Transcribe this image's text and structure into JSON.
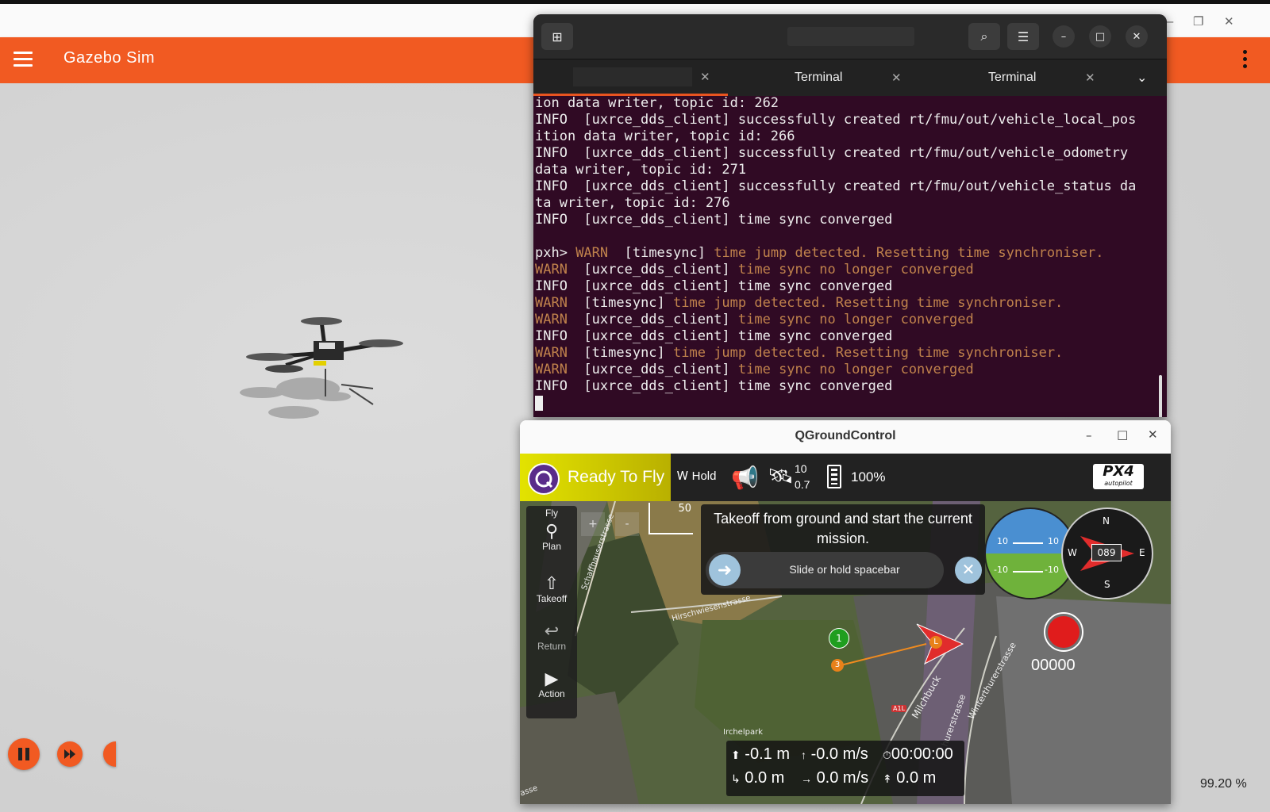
{
  "gazebo": {
    "title": "Gazebo Sim",
    "rtf": "99.20 %"
  },
  "terminal": {
    "tabs": [
      {
        "label": ""
      },
      {
        "label": "Terminal"
      },
      {
        "label": "Terminal"
      }
    ],
    "lines": [
      {
        "text": "ion data writer, topic id: 262",
        "level": "info"
      },
      {
        "text": "INFO  [uxrce_dds_client] successfully created rt/fmu/out/vehicle_local_pos",
        "level": "info"
      },
      {
        "text": "ition data writer, topic id: 266",
        "level": "info"
      },
      {
        "text": "INFO  [uxrce_dds_client] successfully created rt/fmu/out/vehicle_odometry",
        "level": "info"
      },
      {
        "text": "data writer, topic id: 271",
        "level": "info"
      },
      {
        "text": "INFO  [uxrce_dds_client] successfully created rt/fmu/out/vehicle_status da",
        "level": "info"
      },
      {
        "text": "ta writer, topic id: 276",
        "level": "info"
      },
      {
        "text": "INFO  [uxrce_dds_client] time sync converged",
        "level": "info"
      },
      {
        "text": "",
        "level": "info"
      },
      {
        "prompt": "pxh> ",
        "tag": "WARN  ",
        "module": "[timesync] ",
        "msg": "time jump detected. Resetting time synchroniser.",
        "level": "warn"
      },
      {
        "tag": "WARN  ",
        "module": "[uxrce_dds_client] ",
        "msg": "time sync no longer converged",
        "level": "warn"
      },
      {
        "text": "INFO  [uxrce_dds_client] time sync converged",
        "level": "info"
      },
      {
        "tag": "WARN  ",
        "module": "[timesync] ",
        "msg": "time jump detected. Resetting time synchroniser.",
        "level": "warn"
      },
      {
        "tag": "WARN  ",
        "module": "[uxrce_dds_client] ",
        "msg": "time sync no longer converged",
        "level": "warn"
      },
      {
        "text": "INFO  [uxrce_dds_client] time sync converged",
        "level": "info"
      },
      {
        "tag": "WARN  ",
        "module": "[timesync] ",
        "msg": "time jump detected. Resetting time synchroniser.",
        "level": "warn"
      },
      {
        "tag": "WARN  ",
        "module": "[uxrce_dds_client] ",
        "msg": "time sync no longer converged",
        "level": "warn"
      },
      {
        "text": "INFO  [uxrce_dds_client] time sync converged",
        "level": "info"
      }
    ]
  },
  "qgc": {
    "title": "QGroundControl",
    "status": "Ready To Fly",
    "mode": "Hold",
    "satellites": "10",
    "hdop": "0.7",
    "battery": "100%",
    "brand": "PX4",
    "brand_sub": "autopilot",
    "fly_tools": [
      {
        "label": "Plan",
        "icon": "plan-icon"
      },
      {
        "label": "Takeoff",
        "icon": "takeoff-icon"
      },
      {
        "label": "Return",
        "icon": "return-icon"
      },
      {
        "label": "Action",
        "icon": "action-icon"
      }
    ],
    "fly_header": "Fly",
    "zoom_in": "+",
    "zoom_out": "-",
    "scale": "50",
    "guided_message": "Takeoff from ground and start the current mission.",
    "slider_label": "Slide or hold spacebar",
    "attitude": {
      "upper_left": "10",
      "upper_right": "10",
      "lower_left": "-10",
      "lower_right": "-10"
    },
    "compass": {
      "heading": "089",
      "n": "N",
      "s": "S",
      "e": "E",
      "w": "W"
    },
    "record_counter": "00000",
    "map_labels": {
      "street1": "Schaffhauserstrasse",
      "street2": "Hirschwiesenstrasse",
      "street3": "Milchbuck",
      "street4": "Winterthurerstrasse",
      "park": "Irchelpark",
      "road_sign": "A1L",
      "street5": "hurerstrasse",
      "asse": "asse"
    },
    "waypoints": {
      "wp1": "1",
      "wp3": "3",
      "vehicle": "L"
    },
    "telemetry": {
      "altitude": "-0.1 m",
      "vertical_speed": "-0.0 m/s",
      "flight_time": "00:00:00",
      "distance": "0.0 m",
      "ground_speed": "0.0 m/s",
      "distance_home": "0.0 m"
    }
  }
}
